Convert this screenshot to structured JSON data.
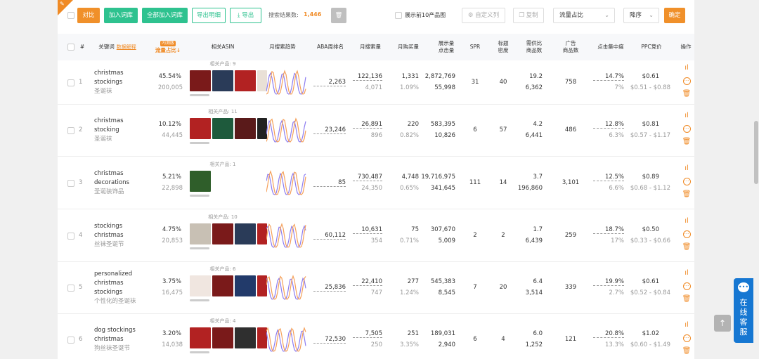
{
  "toolbar": {
    "compare": "对比",
    "add_to_library": "加入词库",
    "add_all_to_library": "全部加入词库",
    "export_details": "导出明细",
    "export": "导出",
    "result_label": "搜索结果数:",
    "result_count": "1,446",
    "top10_label": "展示前10产品图",
    "custom_columns": "自定义列",
    "copy": "复制",
    "sort_field": "流量占比",
    "sort_order": "降序",
    "confirm": "确定"
  },
  "headers": {
    "index": "#",
    "keyword": "关键词",
    "data_explain": "数据解释",
    "traffic_tag": "内测版",
    "traffic": "流量占比↓",
    "asin": "相关ASIN",
    "trend": "月搜索趋势",
    "aba": "ABA周排名",
    "monthly_search": "月搜索量",
    "monthly_purchase": "月购买量",
    "impressions_1": "展示量",
    "impressions_2": "点击量",
    "spr": "SPR",
    "title_density_1": "标题",
    "title_density_2": "密度",
    "supply_1": "需供比",
    "supply_2": "商品数",
    "ad_1": "广告",
    "ad_2": "商品数",
    "click_conc": "点击集中度",
    "ppc": "PPC竞价",
    "ops": "操作"
  },
  "rows": [
    {
      "idx": "1",
      "kw": "christmas stockings",
      "cn": "圣诞袜",
      "pct": "45.54%",
      "traffic": "200,005",
      "rel": "相关产品: 9",
      "aba": "2,263",
      "ms": "122,136",
      "ms2": "4,071",
      "mp": "1,331",
      "mp2": "1.09%",
      "imp": "2,872,769",
      "clk": "55,998",
      "spr": "31",
      "td": "40",
      "sr": "19.2",
      "prod": "6,362",
      "ad": "758",
      "cc": "14.7%",
      "cc2": "7%",
      "ppc": "$0.61",
      "ppc2": "$0.51 - $0.88"
    },
    {
      "idx": "2",
      "kw": "christmas stocking",
      "cn": "圣诞袜",
      "pct": "10.12%",
      "traffic": "44,445",
      "rel": "相关产品: 11",
      "aba": "23,246",
      "ms": "26,891",
      "ms2": "896",
      "mp": "220",
      "mp2": "0.82%",
      "imp": "583,395",
      "clk": "10,826",
      "spr": "6",
      "td": "57",
      "sr": "4.2",
      "prod": "6,441",
      "ad": "486",
      "cc": "12.8%",
      "cc2": "6.3%",
      "ppc": "$0.81",
      "ppc2": "$0.57 - $1.17"
    },
    {
      "idx": "3",
      "kw": "christmas decorations",
      "cn": "圣诞装饰品",
      "pct": "5.21%",
      "traffic": "22,898",
      "rel": "相关产品: 1",
      "aba": "85",
      "ms": "730,487",
      "ms2": "24,350",
      "mp": "4,748",
      "mp2": "0.65%",
      "imp": "19,716,975",
      "clk": "341,645",
      "spr": "111",
      "td": "14",
      "sr": "3.7",
      "prod": "196,860",
      "ad": "3,101",
      "cc": "12.5%",
      "cc2": "6.6%",
      "ppc": "$0.89",
      "ppc2": "$0.68 - $1.12"
    },
    {
      "idx": "4",
      "kw": "stockings christmas",
      "cn": "丝袜圣诞节",
      "pct": "4.75%",
      "traffic": "20,853",
      "rel": "相关产品: 10",
      "aba": "60,112",
      "ms": "10,631",
      "ms2": "354",
      "mp": "75",
      "mp2": "0.71%",
      "imp": "307,670",
      "clk": "5,009",
      "spr": "2",
      "td": "2",
      "sr": "1.7",
      "prod": "6,439",
      "ad": "259",
      "cc": "18.7%",
      "cc2": "17%",
      "ppc": "$0.50",
      "ppc2": "$0.33 - $0.66"
    },
    {
      "idx": "5",
      "kw": "personalized christmas stockings",
      "cn": "个性化的圣诞袜",
      "pct": "3.75%",
      "traffic": "16,475",
      "rel": "相关产品: 6",
      "aba": "25,836",
      "ms": "22,410",
      "ms2": "747",
      "mp": "277",
      "mp2": "1.24%",
      "imp": "545,383",
      "clk": "8,545",
      "spr": "7",
      "td": "20",
      "sr": "6.4",
      "prod": "3,514",
      "ad": "339",
      "cc": "19.9%",
      "cc2": "2.7%",
      "ppc": "$0.61",
      "ppc2": "$0.52 - $0.84"
    },
    {
      "idx": "6",
      "kw": "dog stockings christmas",
      "cn": "狗丝袜圣诞节",
      "pct": "3.20%",
      "traffic": "14,038",
      "rel": "相关产品: 4",
      "aba": "72,530",
      "ms": "7,505",
      "ms2": "250",
      "mp": "251",
      "mp2": "3.35%",
      "imp": "189,031",
      "clk": "2,940",
      "spr": "6",
      "td": "4",
      "sr": "6.0",
      "prod": "1,252",
      "ad": "121",
      "cc": "20.8%",
      "cc2": "13.3%",
      "ppc": "$1.02",
      "ppc2": "$0.60 - $1.49"
    }
  ],
  "service": "在线客服",
  "icons": {
    "pin": "pin-icon",
    "download": "download-icon",
    "delete": "trash-icon",
    "gear": "gear-icon",
    "copy": "copy-icon",
    "chart": "bar-chart-icon",
    "more": "more-icon",
    "top": "arrow-up-icon",
    "chat": "chat-icon"
  },
  "colors": {
    "accent": "#f08a24",
    "green": "#2ec28f",
    "blue": "#1677d2",
    "trend_orange": "#f5a05a",
    "trend_purple": "#8c7cf0"
  }
}
